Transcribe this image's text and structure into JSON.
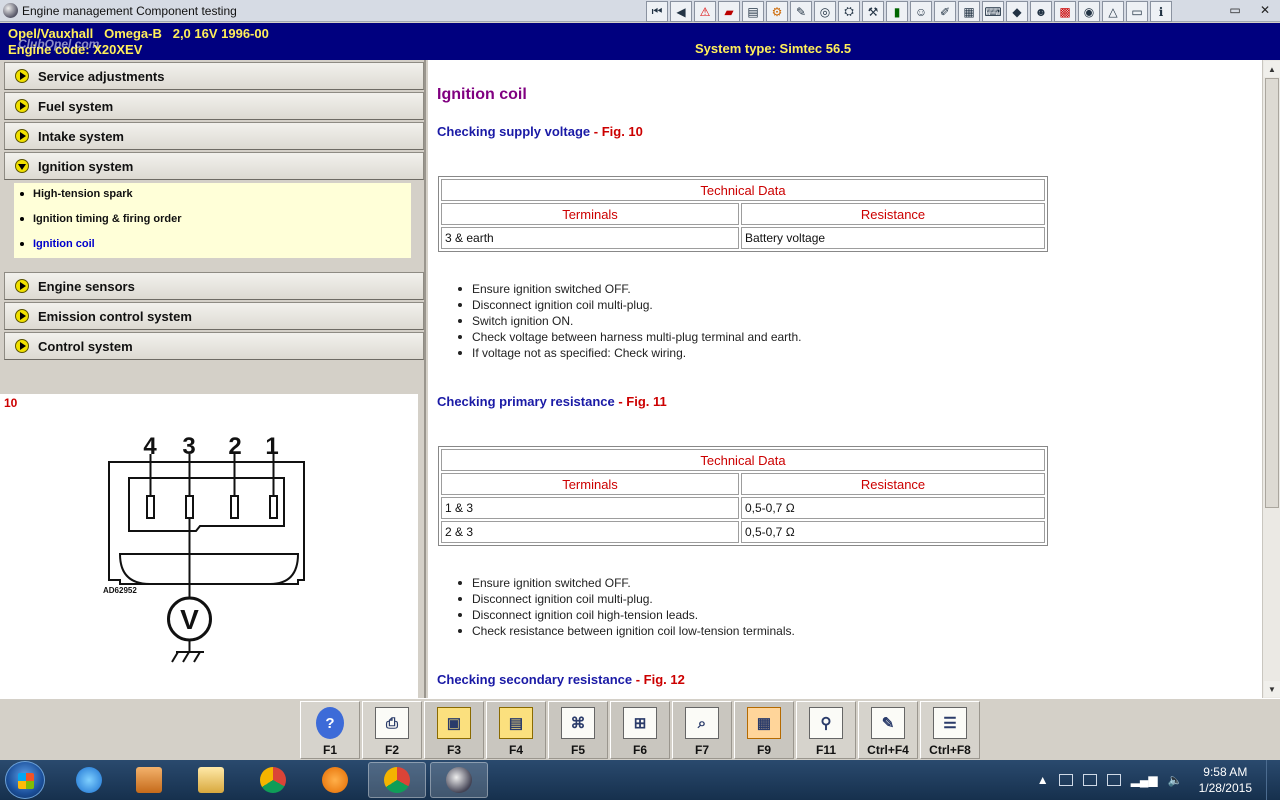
{
  "window": {
    "title": "Engine management Component testing"
  },
  "header": {
    "vehicle": "Opel/Vauxhall   Omega-B   2,0 16V 1996-00",
    "engine_code": "Engine code: X20XEV",
    "system_type": "System type: Simtec 56.5",
    "watermark": "ClubOpel.com"
  },
  "sidebar": {
    "items": [
      {
        "label": "Service adjustments"
      },
      {
        "label": "Fuel system"
      },
      {
        "label": "Intake system"
      },
      {
        "label": "Ignition system"
      },
      {
        "label": "Engine sensors"
      },
      {
        "label": "Emission control system"
      },
      {
        "label": "Control system"
      }
    ],
    "subitems": [
      {
        "label": "High-tension spark"
      },
      {
        "label": "Ignition timing & firing order"
      },
      {
        "label": "Ignition coil"
      }
    ]
  },
  "figure": {
    "number": "10",
    "pins": [
      "4",
      "3",
      "2",
      "1"
    ],
    "code": "AD62952",
    "meter": "V"
  },
  "content": {
    "title": "Ignition coil",
    "sections": [
      {
        "heading": "Checking supply voltage",
        "fig": " - Fig. 10",
        "table_title": "Technical Data",
        "col1": "Terminals",
        "col2": "Resistance",
        "rows": [
          [
            "3 & earth",
            "Battery voltage"
          ]
        ],
        "steps": [
          "Ensure ignition switched OFF.",
          "Disconnect ignition coil multi-plug.",
          "Switch ignition ON.",
          "Check voltage between harness multi-plug terminal and earth.",
          "If voltage not as specified: Check wiring."
        ]
      },
      {
        "heading": "Checking primary resistance",
        "fig": " - Fig. 11",
        "table_title": "Technical Data",
        "col1": "Terminals",
        "col2": "Resistance",
        "rows": [
          [
            "1 & 3",
            "0,5-0,7 Ω"
          ],
          [
            "2 & 3",
            "0,5-0,7 Ω"
          ]
        ],
        "steps": [
          "Ensure ignition switched OFF.",
          "Disconnect ignition coil multi-plug.",
          "Disconnect ignition coil high-tension leads.",
          "Check resistance between ignition coil low-tension terminals."
        ]
      },
      {
        "heading": "Checking secondary resistance",
        "fig": " - Fig. 12"
      }
    ]
  },
  "fkeys": [
    {
      "label": "F1",
      "icon": "help-icon"
    },
    {
      "label": "F2",
      "icon": "printer-icon"
    },
    {
      "label": "F3",
      "icon": "component-location-icon"
    },
    {
      "label": "F4",
      "icon": "component-list-icon"
    },
    {
      "label": "F5",
      "icon": "wiring-diagram-icon"
    },
    {
      "label": "F6",
      "icon": "connector-pinout-icon"
    },
    {
      "label": "F7",
      "icon": "search-icon"
    },
    {
      "label": "F9",
      "icon": "ecu-icon"
    },
    {
      "label": "F11",
      "icon": "magnifier-icon"
    },
    {
      "label": "Ctrl+F4",
      "icon": "notes-icon"
    },
    {
      "label": "Ctrl+F8",
      "icon": "data-list-icon"
    }
  ],
  "taskbar": {
    "time": "9:58 AM",
    "date": "1/28/2015"
  }
}
